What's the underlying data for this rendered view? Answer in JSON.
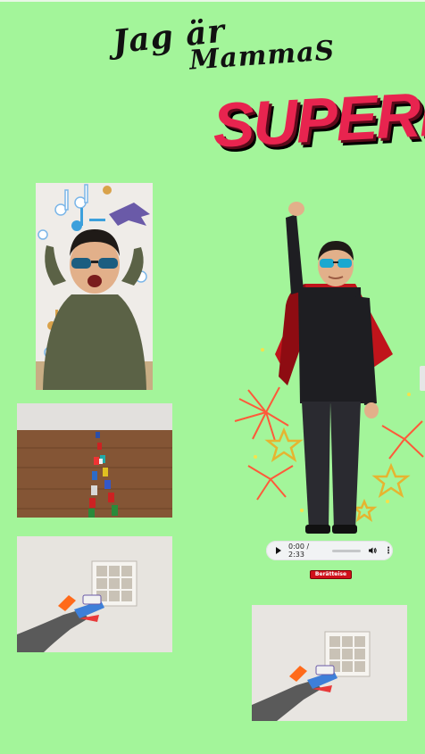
{
  "title": {
    "line1": "Jag är",
    "line2": "MammaS",
    "line3": "SUPERHJÄLTE"
  },
  "audio": {
    "time": "0:00 / 2:33",
    "progress": 0
  },
  "button": {
    "label": "Berätteise"
  },
  "colors": {
    "background": "#a3f59a",
    "title_accent": "#e8244f",
    "button": "#d0101a",
    "cape": "#c0141b"
  },
  "icons": {
    "play": "play-icon",
    "volume": "volume-icon",
    "more": "more-vert-icon"
  }
}
